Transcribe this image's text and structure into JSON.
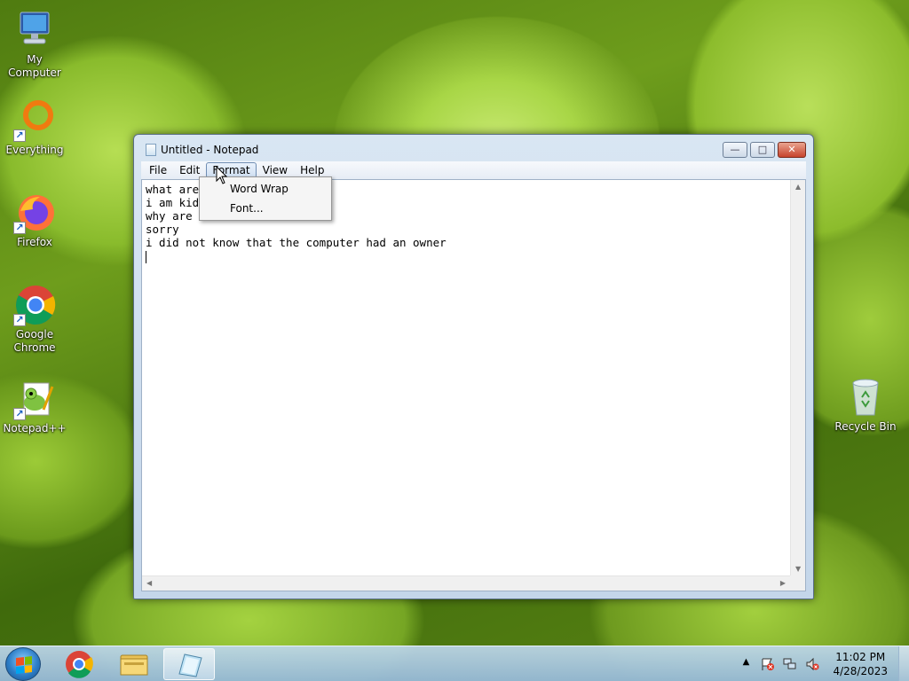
{
  "desktop": {
    "icons": [
      {
        "label": "My Computer"
      },
      {
        "label": "Everything"
      },
      {
        "label": "Firefox"
      },
      {
        "label": "Google Chrome"
      },
      {
        "label": "Notepad++"
      },
      {
        "label": "Recycle Bin"
      }
    ]
  },
  "window": {
    "title": "Untitled - Notepad",
    "minimize_glyph": "—",
    "maximize_glyph": "□",
    "close_glyph": "✕"
  },
  "menubar": {
    "items": [
      {
        "label": "File"
      },
      {
        "label": "Edit"
      },
      {
        "label": "Format",
        "active": true
      },
      {
        "label": "View"
      },
      {
        "label": "Help"
      }
    ]
  },
  "format_menu": {
    "items": [
      {
        "label": "Word Wrap"
      },
      {
        "label": "Font..."
      }
    ]
  },
  "editor": {
    "lines": [
      "what are",
      "i am kid",
      "why are",
      "sorry",
      "i did not know that the computer had an owner"
    ]
  },
  "taskbar": {
    "clock_time": "11:02 PM",
    "clock_date": "4/28/2023"
  },
  "colors": {
    "accent": "#2e7fc8",
    "close_button": "#c7432c"
  }
}
